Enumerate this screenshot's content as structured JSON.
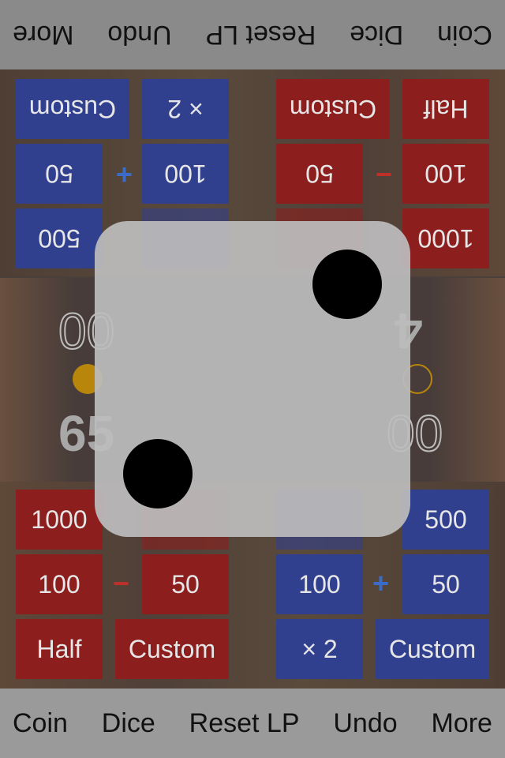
{
  "toolbar": {
    "items": [
      "Coin",
      "Dice",
      "Reset LP",
      "Undo",
      "More"
    ]
  },
  "top_player": {
    "buttons": {
      "r1": "1000",
      "r1_hidden_red": "",
      "r1_hidden_blue": "",
      "r1b": "500",
      "minus_r": "100",
      "minus_l": "50",
      "plus_r": "100",
      "plus_l": "50",
      "half": "Half",
      "custom_red": "Custom",
      "times2": "× 2",
      "custom_blue": "Custom",
      "minus": "−",
      "plus": "+"
    },
    "lp_visible": "4",
    "lp_secondary_visible": "00"
  },
  "bottom_player": {
    "buttons": {
      "r1": "1000",
      "r1_hidden_red": "",
      "r1_hidden_blue": "",
      "r1b": "500",
      "minus_r": "100",
      "minus_l": "50",
      "plus_r": "100",
      "plus_l": "50",
      "half": "Half",
      "custom_red": "Custom",
      "times2": "× 2",
      "custom_blue": "Custom",
      "minus": "−",
      "plus": "+"
    },
    "lp_visible": "65",
    "lp_secondary_visible": "00"
  },
  "coin": {
    "active_color": "#b8860b",
    "inactive": "outline"
  },
  "dice": {
    "value": 2
  },
  "colors": {
    "red": "#8c1e1e",
    "blue": "#30408e",
    "bar": "#9a9a9a"
  }
}
